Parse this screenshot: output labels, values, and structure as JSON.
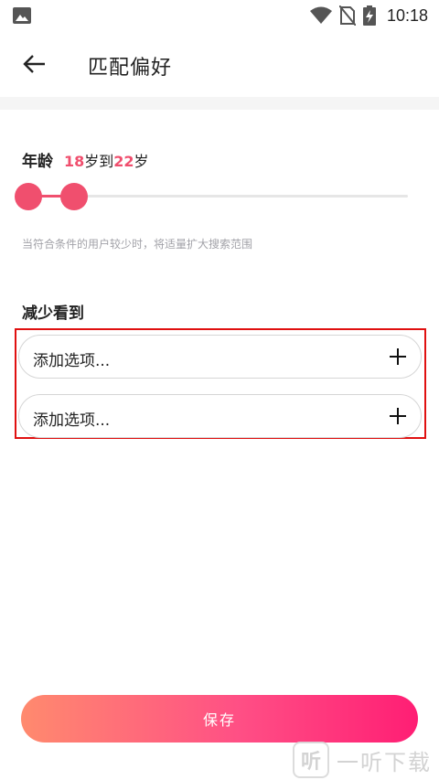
{
  "status_bar": {
    "time": "10:18"
  },
  "header": {
    "title": "匹配偏好"
  },
  "age": {
    "label": "年龄",
    "min": "18",
    "max": "22",
    "unit_min": "岁到",
    "unit_max": "岁",
    "accent_color": "#f04f6e",
    "hint": "当符合条件的用户较少时，将适量扩大搜索范围"
  },
  "reduce_section": {
    "title": "减少看到",
    "options": [
      {
        "label": "添加选项..."
      },
      {
        "label": "添加选项..."
      }
    ]
  },
  "footer": {
    "save_label": "保存"
  },
  "watermark": {
    "text": "一听下载",
    "logo_char": "听"
  }
}
